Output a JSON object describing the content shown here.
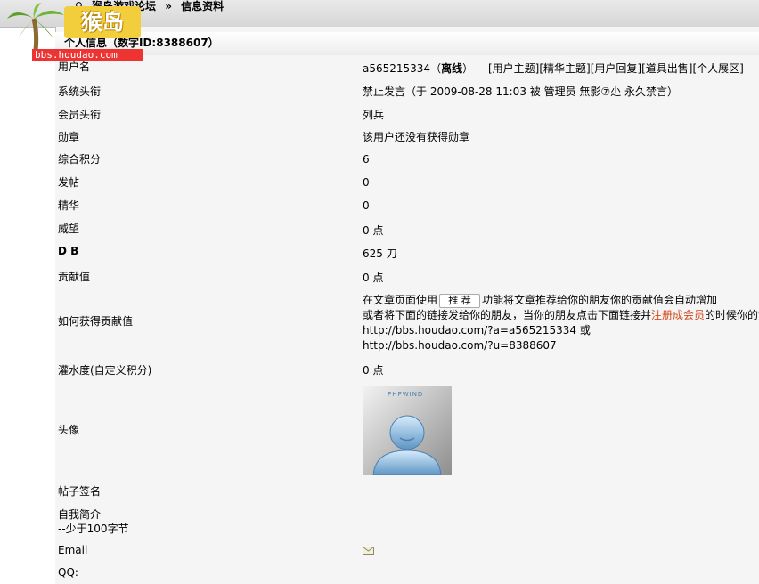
{
  "breadcrumb": {
    "forum": "猴岛游戏论坛",
    "separator": "»",
    "current": "信息资料"
  },
  "logo": {
    "badge": "猴岛",
    "url": "bbs.houdao.com"
  },
  "section_title": "个人信息（数字ID:8388607）",
  "rows": {
    "username": {
      "label": "用户名",
      "name": "a565215334",
      "open_paren": "（",
      "status": "离线",
      "close_paren": "）---",
      "links": [
        "[用户主题]",
        "[精华主题]",
        "[用户回复]",
        "[道具出售]",
        "[个人展区]"
      ]
    },
    "system_title": {
      "label": "系统头衔",
      "value": "禁止发言（于 2009-08-28 11:03 被 管理员 無影⑦尐 永久禁言）"
    },
    "member_title": {
      "label": "会员头衔",
      "value": "列兵"
    },
    "medal": {
      "label": "勋章",
      "value": "该用户还没有获得勋章"
    },
    "total_points": {
      "label": "综合积分",
      "value": "6"
    },
    "posts": {
      "label": "发帖",
      "value": "0"
    },
    "digest": {
      "label": "精华",
      "value": "0"
    },
    "prestige": {
      "label": "威望",
      "value": "0 点"
    },
    "db": {
      "label": "D B",
      "value": "625 刀"
    },
    "contribution": {
      "label": "贡献值",
      "value": "0 点"
    },
    "how_contribution": {
      "label": "如何获得贡献值",
      "line1_pre": "在文章页面使用",
      "button": "推 荐",
      "line1_post": "功能将文章推荐给你的朋友你的贡献值会自动增加",
      "line2_pre": "或者将下面的链接发给你的朋友，当你的朋友点击下面链接并",
      "line2_link": "注册成会员",
      "line2_post": "的时候你的贡",
      "link1": "http://bbs.houdao.com/?a=a565215334 或",
      "link2": "http://bbs.houdao.com/?u=8388607"
    },
    "water": {
      "label": "灌水度(自定义积分)",
      "value": "0 点"
    },
    "avatar": {
      "label": "头像",
      "brand": "PHPWIND"
    },
    "signature": {
      "label": "帖子签名",
      "value": ""
    },
    "intro": {
      "label": "自我简介",
      "hint": "--少于100字节",
      "value": ""
    },
    "email": {
      "label": "Email"
    },
    "qq": {
      "label": "QQ:"
    }
  },
  "colors": {
    "link_red": "#d24a1e",
    "row_bg": "#f5f5f5",
    "row_border": "#d9d9d9"
  }
}
